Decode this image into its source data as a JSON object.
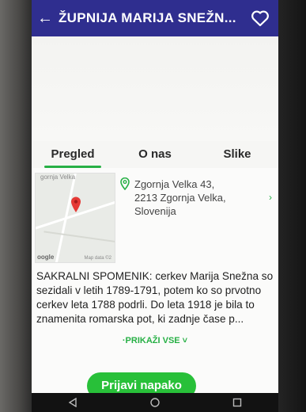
{
  "appbar": {
    "title": "ŽUPNIJA MARIJA SNEŽN...",
    "back_icon": "arrow-left-icon",
    "favorite_icon": "heart-outline-icon",
    "color": "#2f2e8f"
  },
  "tabs": [
    {
      "label": "Pregled",
      "active": true
    },
    {
      "label": "O nas",
      "active": false
    },
    {
      "label": "Slike",
      "active": false
    }
  ],
  "map": {
    "place_label": "gornja Velka",
    "google_label": "oogle",
    "map_data_label": "Map data ©2"
  },
  "address": {
    "lines": [
      "Zgornja Velka 43,",
      "2213 Zgornja Velka,",
      "Slovenija"
    ],
    "icon": "location-pin-outline-icon"
  },
  "description": "SAKRALNI SPOMENIK: cerkev Marija Snežna so sezidali v letih 1789-1791, potem ko so prvotno cerkev leta 1788 podrli. Do leta 1918 je bila to znamenita romarska pot, ki zadnje čase p...",
  "show_all_label": "·PRIKAŽI VSE ˅",
  "report_button_label": "Prijavi napako",
  "accent_color": "#27b045",
  "navbar": {
    "icons": [
      "back-triangle-icon",
      "home-circle-icon",
      "recents-square-icon"
    ]
  }
}
